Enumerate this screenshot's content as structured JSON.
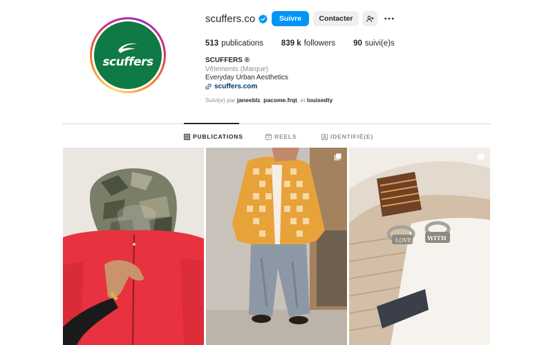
{
  "profile": {
    "username": "scuffers.co",
    "avatar_text": "scuffers",
    "verified": true,
    "brand_color": "#0f7a45"
  },
  "actions": {
    "follow_label": "Suivre",
    "contact_label": "Contacter",
    "add_user_icon": "person-plus-icon",
    "more_icon": "more-horizontal-icon"
  },
  "stats": {
    "posts_count": "513",
    "posts_label": "publications",
    "followers_count": "839 k",
    "followers_label": "followers",
    "following_count": "90",
    "following_label": "suivi(e)s"
  },
  "bio": {
    "name": "SCUFFERS ®",
    "category": "Vêtements (Marque)",
    "tagline": "Everyday Urban Aesthetics",
    "link": "scuffers.com"
  },
  "followed_by": {
    "prefix": "Suivi(e) par",
    "user1": "janeeblz",
    "sep": ",",
    "user2": "pacome.frqt",
    "and": ", et",
    "user3": "louisedty"
  },
  "tabs": [
    {
      "label": "PUBLICATIONS",
      "icon": "grid-icon",
      "active": true
    },
    {
      "label": "REELS",
      "icon": "reels-icon",
      "active": false
    },
    {
      "label": "IDENTIFIÉ(E)",
      "icon": "tagged-icon",
      "active": false
    }
  ],
  "posts": [
    {
      "subject": "red hoodie with camo hood",
      "multi": false
    },
    {
      "subject": "orange checkered cardigan with baggy jeans",
      "multi": true
    },
    {
      "subject": "silver rings engraved LOVE and WITH",
      "multi": true
    }
  ],
  "colors": {
    "accent": "#0095f6",
    "secondary_button": "#efefef",
    "muted_text": "#8e8e8e",
    "link": "#00376b"
  }
}
